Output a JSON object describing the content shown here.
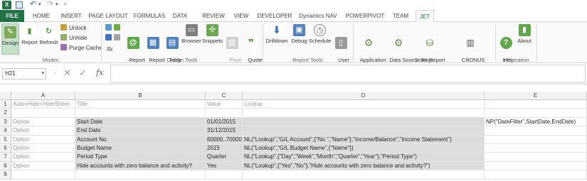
{
  "quick_access": {
    "app_glyph": "X"
  },
  "tabs": [
    "FILE",
    "HOME",
    "INSERT",
    "PAGE LAYOUT",
    "FORMULAS",
    "DATA",
    "REVIEW",
    "VIEW",
    "DEVELOPER",
    "Dynamics NAV",
    "POWERPIVOT",
    "TEAM",
    "JET"
  ],
  "ribbon": {
    "modes": {
      "design": "Design",
      "report": "Report",
      "refresh": "Refresh",
      "unlock": "Unlock",
      "unhide": "Unhide",
      "purge_cache": "Purge Cache",
      "label": "Modes"
    },
    "design_tools": {
      "fx": "Ifx",
      "report_wizard": "Report\nWizard",
      "report_builder": "Report\nBuilder",
      "table_builder": "Table\nBuilder",
      "browser": "Browser",
      "snippets": "Snippets",
      "pivot_table": "Pivot\nTable ▾",
      "quote": "Quote\n▾",
      "label": "Design Tools"
    },
    "report_tools": {
      "drilldown": "Drilldown",
      "debug": "Debug",
      "schedule": "Schedule",
      "user_data": "User\nData ▾",
      "label": "Report Tools"
    },
    "settings": {
      "application_settings": "Application\nSettings",
      "data_source_settings": "Data Source\nSettings",
      "jet_report_connection": "Jet Report\nConnection ▾",
      "cronus": "CRONUS\nInternational Ltd. ▾",
      "label": "Settings"
    },
    "information": {
      "help": "Help\n▾",
      "about": "About",
      "label": "Information"
    }
  },
  "formula_bar": {
    "name_box": "H21",
    "cancel_icon": "✕",
    "enter_icon": "✓",
    "fx": "fx",
    "formula": ""
  },
  "columns": [
    "A",
    "B",
    "C",
    "D",
    "E"
  ],
  "rows": [
    {
      "n": "1",
      "A": "Auto+Hide+HideSheet",
      "B": "Title",
      "C": "Value",
      "D": "Lookup",
      "E": ""
    },
    {
      "n": "2",
      "A": "",
      "B": "",
      "C": "",
      "D": "",
      "E": ""
    },
    {
      "n": "3",
      "A": "Option",
      "B": "Start Date",
      "C": "01/01/2015",
      "D": "",
      "E": "NP(\"DateFilter\",StartDate,EndDate)"
    },
    {
      "n": "4",
      "A": "Option",
      "B": "End Date",
      "C": "31/12/2015",
      "D": "",
      "E": ""
    },
    {
      "n": "5",
      "A": "Option",
      "B": "Account No.",
      "C": "60000..70000",
      "D": "NL(\"Lookup\",\"G/L Account\",{\"No.\",\"Name\"},\"Income/Balance\",\"Income Statement\")",
      "E": ""
    },
    {
      "n": "6",
      "A": "Option",
      "B": "Budget Name",
      "C": "2015",
      "D": "NL(\"Lookup\",\"G/L Budget Name\",{\"Name\"})",
      "E": ""
    },
    {
      "n": "7",
      "A": "Option",
      "B": "Period Type",
      "C": "Quarter",
      "D": "NL(\"Lookup\",{\"Day\",\"Week\",\"Month\",\"Quarter\",\"Year\"},\"Period Type\")",
      "E": ""
    },
    {
      "n": "8",
      "A": "Option",
      "B": "Hide accounts with zero balance and activity?",
      "C": "Yes",
      "D": "NL(\"Lookup\",{\"Yes\",\"No\"},\"Hide accounts with zero balance and activity?\")",
      "E": ""
    },
    {
      "n": "9",
      "A": "",
      "B": "",
      "C": "",
      "D": "",
      "E": ""
    }
  ],
  "colors": {
    "excel_green": "#217346",
    "option_gray_fill": "#dcdcdc",
    "muted_text": "#9a9a9a"
  }
}
